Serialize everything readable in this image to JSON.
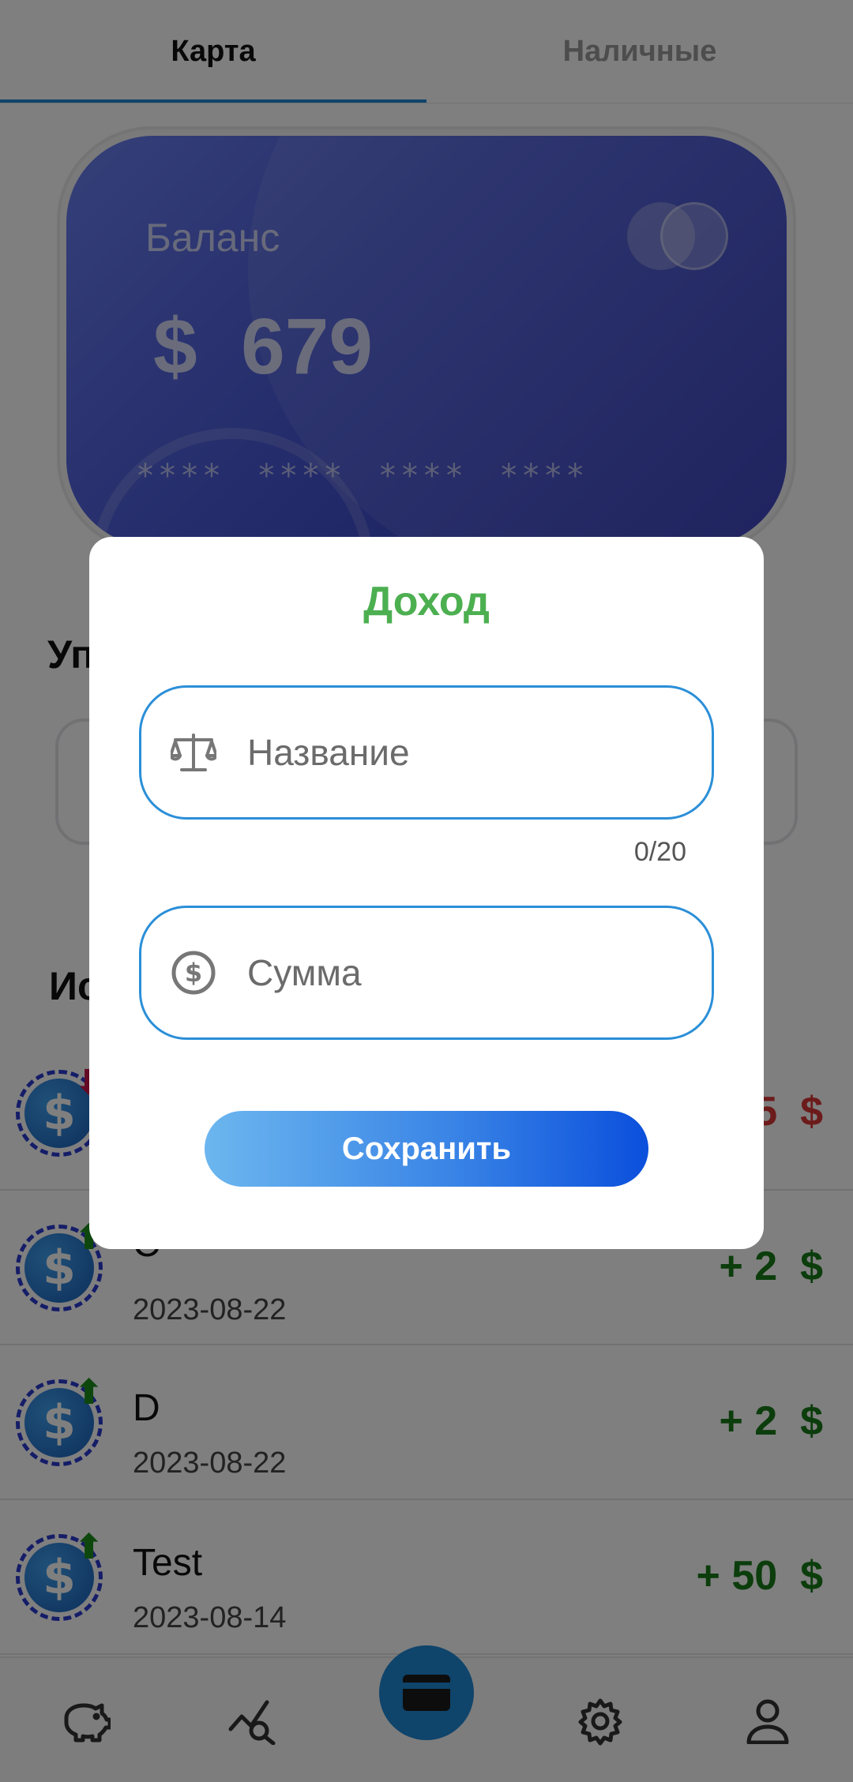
{
  "tabs": [
    {
      "label": "Карта",
      "active": true
    },
    {
      "label": "Наличные",
      "active": false
    }
  ],
  "card": {
    "balance_label": "Баланс",
    "balance_value": "$  679",
    "masked_number": "****  ****  ****  ****"
  },
  "sections": {
    "manage_title": "Уп",
    "history_title": "Ис"
  },
  "transactions": [
    {
      "name": "",
      "date": "",
      "amount": "5  $",
      "type": "expense"
    },
    {
      "name": "C",
      "date": "2023-08-22",
      "amount": "+ 2  $",
      "type": "income"
    },
    {
      "name": "D",
      "date": "2023-08-22",
      "amount": "+ 2  $",
      "type": "income"
    },
    {
      "name": "Test",
      "date": "2023-08-14",
      "amount": "+ 50  $",
      "type": "income"
    }
  ],
  "bottom_nav": [
    "piggy-bank-icon",
    "analytics-icon",
    "card-icon",
    "settings-icon",
    "profile-icon"
  ],
  "dialog": {
    "title": "Доход",
    "name_placeholder": "Название",
    "name_counter": "0/20",
    "amount_placeholder": "Сумма",
    "save_label": "Сохранить"
  },
  "colors": {
    "accent": "#1f88d6",
    "income": "#187a18",
    "expense": "#d93636",
    "dialog_title": "#4caf50"
  }
}
